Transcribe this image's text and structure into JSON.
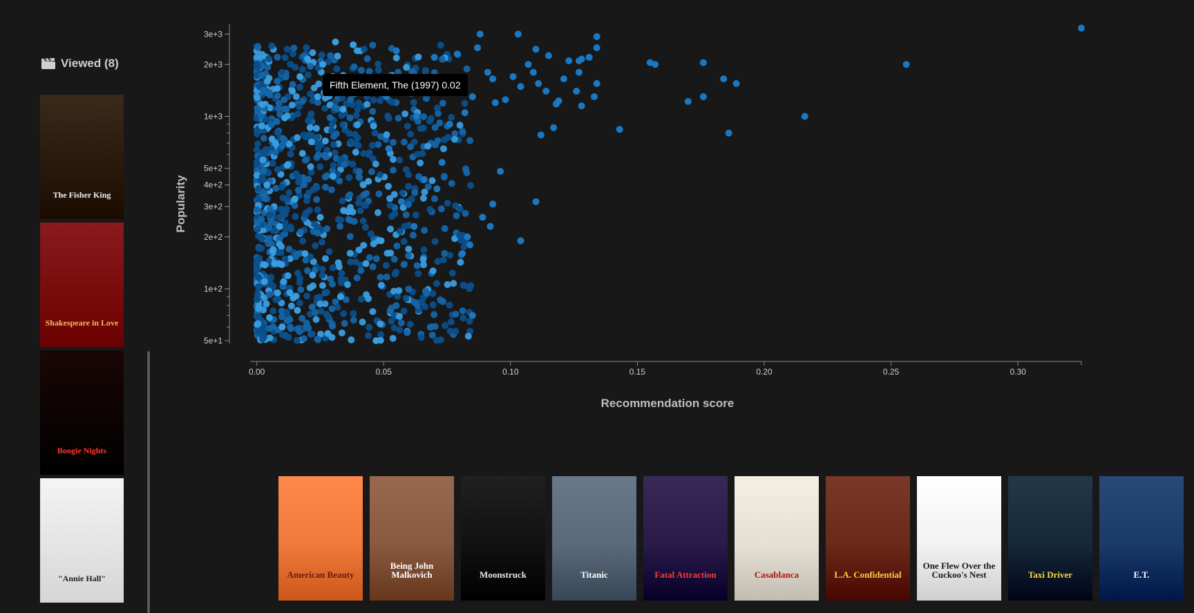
{
  "sidebar": {
    "viewed_label": "Viewed (8)",
    "icon": "clapperboard-icon",
    "items": [
      {
        "title": "The Fisher King",
        "bg": "#3a2a1a",
        "fg": "#f2f2f2"
      },
      {
        "title": "Shakespeare in Love",
        "bg": "#8a1a1e",
        "fg": "#f0c060"
      },
      {
        "title": "Boogie Nights",
        "bg": "#1a0606",
        "fg": "#ff3a2a"
      },
      {
        "title": "\"Annie Hall\"",
        "bg": "#f4f4f4",
        "fg": "#222222"
      }
    ]
  },
  "tooltip": {
    "text": "Fifth Element, The (1997) 0.02"
  },
  "chart_data": {
    "type": "scatter",
    "xlabel": "Recommendation score",
    "ylabel": "Popularity",
    "x_ticks": [
      0.0,
      0.05,
      0.1,
      0.15,
      0.2,
      0.25,
      0.3
    ],
    "x_tick_labels": [
      "0.00",
      "0.05",
      "0.10",
      "0.15",
      "0.20",
      "0.25",
      "0.30"
    ],
    "xlim": [
      -0.001,
      0.325
    ],
    "y_scale": "log",
    "ylim": [
      50,
      3300
    ],
    "y_ticks": [
      50,
      100,
      200,
      300,
      400,
      500,
      1000,
      2000,
      3000
    ],
    "y_tick_labels": [
      "5e+1",
      "1e+2",
      "2e+2",
      "3e+2",
      "4e+2",
      "5e+2",
      "1e+3",
      "2e+3",
      "3e+3"
    ],
    "point_color_dark": "#0b4f8a",
    "point_color_light": "#3a9de0",
    "points": [
      [
        0.325,
        3250
      ],
      [
        0.256,
        2000
      ],
      [
        0.216,
        1000
      ],
      [
        0.189,
        1550
      ],
      [
        0.186,
        800
      ],
      [
        0.184,
        1650
      ],
      [
        0.176,
        2050
      ],
      [
        0.176,
        1300
      ],
      [
        0.17,
        1220
      ],
      [
        0.157,
        2000
      ],
      [
        0.155,
        2050
      ],
      [
        0.143,
        840
      ],
      [
        0.134,
        2900
      ],
      [
        0.134,
        2500
      ],
      [
        0.134,
        1550
      ],
      [
        0.133,
        1300
      ],
      [
        0.131,
        2200
      ],
      [
        0.128,
        2150
      ],
      [
        0.128,
        1150
      ],
      [
        0.127,
        2100
      ],
      [
        0.127,
        1800
      ],
      [
        0.126,
        1400
      ],
      [
        0.123,
        2100
      ],
      [
        0.121,
        1650
      ],
      [
        0.119,
        1230
      ],
      [
        0.118,
        1180
      ],
      [
        0.117,
        860
      ],
      [
        0.115,
        2250
      ],
      [
        0.114,
        1400
      ],
      [
        0.112,
        780
      ],
      [
        0.111,
        1550
      ],
      [
        0.11,
        2450
      ],
      [
        0.11,
        320
      ],
      [
        0.109,
        1800
      ],
      [
        0.107,
        2000
      ],
      [
        0.104,
        190
      ],
      [
        0.104,
        1490
      ],
      [
        0.103,
        3000
      ],
      [
        0.101,
        1700
      ],
      [
        0.098,
        1250
      ],
      [
        0.096,
        480
      ],
      [
        0.094,
        1200
      ],
      [
        0.093,
        310
      ],
      [
        0.093,
        1650
      ],
      [
        0.092,
        230
      ],
      [
        0.091,
        1800
      ],
      [
        0.089,
        260
      ],
      [
        0.088,
        3000
      ],
      [
        0.087,
        2500
      ],
      [
        0.085,
        70
      ],
      [
        0.085,
        1300
      ],
      [
        0.084,
        180
      ],
      [
        0.083,
        200
      ],
      [
        0.082,
        1050
      ],
      [
        0.081,
        160
      ],
      [
        0.079,
        2300
      ],
      [
        0.076,
        900
      ],
      [
        0.074,
        1500
      ],
      [
        0.073,
        540
      ],
      [
        0.071,
        380
      ],
      [
        0.07,
        2200
      ],
      [
        0.068,
        1450
      ],
      [
        0.066,
        430
      ],
      [
        0.063,
        1000
      ],
      [
        0.062,
        230
      ],
      [
        0.058,
        1500
      ],
      [
        0.057,
        320
      ],
      [
        0.055,
        2400
      ],
      [
        0.052,
        650
      ],
      [
        0.051,
        1300
      ],
      [
        0.049,
        190
      ],
      [
        0.047,
        50
      ],
      [
        0.046,
        880
      ],
      [
        0.044,
        420
      ],
      [
        0.043,
        140
      ],
      [
        0.041,
        1600
      ],
      [
        0.039,
        620
      ],
      [
        0.038,
        2600
      ],
      [
        0.036,
        280
      ],
      [
        0.034,
        1100
      ],
      [
        0.033,
        90
      ],
      [
        0.031,
        2700
      ],
      [
        0.03,
        450
      ],
      [
        0.029,
        1500
      ],
      [
        0.028,
        55
      ],
      [
        0.027,
        720
      ],
      [
        0.026,
        2000
      ],
      [
        0.025,
        260
      ],
      [
        0.024,
        1300
      ],
      [
        0.022,
        120
      ],
      [
        0.021,
        860
      ],
      [
        0.02,
        2150
      ],
      [
        0.019,
        160
      ],
      [
        0.018,
        610
      ],
      [
        0.017,
        1700
      ],
      [
        0.016,
        75
      ],
      [
        0.015,
        330
      ],
      [
        0.014,
        1400
      ],
      [
        0.013,
        95
      ],
      [
        0.012,
        520
      ],
      [
        0.011,
        980
      ],
      [
        0.01,
        60
      ],
      [
        0.009,
        230
      ],
      [
        0.008,
        1450
      ],
      [
        0.007,
        140
      ],
      [
        0.006,
        740
      ],
      [
        0.005,
        68
      ],
      [
        0.004,
        400
      ],
      [
        0.003,
        110
      ],
      [
        0.002,
        880
      ]
    ]
  },
  "recommendations": [
    {
      "title": "American Beauty",
      "bg": "#f07a3c",
      "fg": "#6a1a10"
    },
    {
      "title": "Being John Malkovich",
      "bg": "#8a5a40",
      "fg": "#ffffff"
    },
    {
      "title": "Moonstruck",
      "bg": "#111111",
      "fg": "#e8e8e8"
    },
    {
      "title": "Titanic",
      "bg": "#5a6a7a",
      "fg": "#ffffff"
    },
    {
      "title": "Fatal Attraction",
      "bg": "#2a1a4a",
      "fg": "#ff3a3a"
    },
    {
      "title": "Casablanca",
      "bg": "#e6e0d4",
      "fg": "#b01010"
    },
    {
      "title": "L.A. Confidential",
      "bg": "#6a2a1a",
      "fg": "#ffd040"
    },
    {
      "title": "One Flew Over the Cuckoo's Nest",
      "bg": "#f2f2f2",
      "fg": "#1a1a1a"
    },
    {
      "title": "Taxi Driver",
      "bg": "#14283a",
      "fg": "#ffd83a"
    },
    {
      "title": "E.T.",
      "bg": "#1a3a6a",
      "fg": "#ffffff"
    }
  ]
}
